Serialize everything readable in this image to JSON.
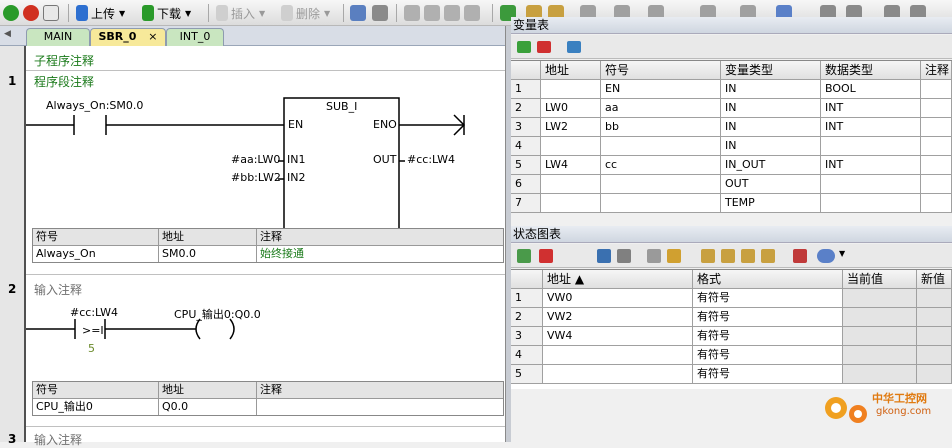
{
  "toolbar": {
    "upload_label": "上传",
    "download_label": "下载",
    "insert_label": "插入",
    "delete_label": "删除"
  },
  "tabs": [
    "MAIN",
    "SBR_0",
    "INT_0"
  ],
  "editor": {
    "sub_comment": "子程序注释",
    "net1": {
      "number": "1",
      "comment": "程序段注释",
      "contact_label": "Always_On:SM0.0",
      "box_title": "SUB_I",
      "pins": {
        "en": "EN",
        "eno": "ENO",
        "in1": "IN1",
        "in2": "IN2",
        "out": "OUT"
      },
      "in1_operand": "#aa:LW0",
      "in2_operand": "#bb:LW2",
      "out_operand": "#cc:LW4",
      "symtable": {
        "headers": [
          "符号",
          "地址",
          "注释"
        ],
        "rows": [
          [
            "Always_On",
            "SM0.0",
            "始终接通"
          ]
        ]
      }
    },
    "net2": {
      "number": "2",
      "comment": "输入注释",
      "contact_label": "#cc:LW4",
      "compare_op": ">=I",
      "compare_value": "5",
      "coil_label": "CPU_输出0:Q0.0",
      "symtable": {
        "headers": [
          "符号",
          "地址",
          "注释"
        ],
        "rows": [
          [
            "CPU_输出0",
            "Q0.0",
            ""
          ]
        ]
      }
    },
    "net3": {
      "number": "3",
      "comment": "输入注释"
    }
  },
  "var_table": {
    "title": "变量表",
    "headers": [
      "",
      "地址",
      "符号",
      "变量类型",
      "数据类型",
      "注释"
    ],
    "rows": [
      [
        "1",
        "",
        "EN",
        "IN",
        "BOOL",
        ""
      ],
      [
        "2",
        "LW0",
        "aa",
        "IN",
        "INT",
        ""
      ],
      [
        "3",
        "LW2",
        "bb",
        "IN",
        "INT",
        ""
      ],
      [
        "4",
        "",
        "",
        "IN",
        "",
        ""
      ],
      [
        "5",
        "LW4",
        "cc",
        "IN_OUT",
        "INT",
        ""
      ],
      [
        "6",
        "",
        "",
        "OUT",
        "",
        ""
      ],
      [
        "7",
        "",
        "",
        "TEMP",
        "",
        ""
      ]
    ]
  },
  "status_chart": {
    "title": "状态图表",
    "headers": [
      "",
      "地址 ▲",
      "格式",
      "当前值",
      "新值"
    ],
    "rows": [
      [
        "1",
        "VW0",
        "有符号",
        "",
        ""
      ],
      [
        "2",
        "VW2",
        "有符号",
        "",
        ""
      ],
      [
        "3",
        "VW4",
        "有符号",
        "",
        ""
      ],
      [
        "4",
        "",
        "有符号",
        "",
        ""
      ],
      [
        "5",
        "",
        "有符号",
        "",
        ""
      ]
    ]
  },
  "watermark": {
    "brand": "中华工控网",
    "domain": "gkong.com"
  },
  "colors": {
    "accent": "#1a7a1a",
    "tab_active": "#f7e99a",
    "tab_inactive": "#c9e6c0",
    "logo_orange": "#f0a020"
  }
}
